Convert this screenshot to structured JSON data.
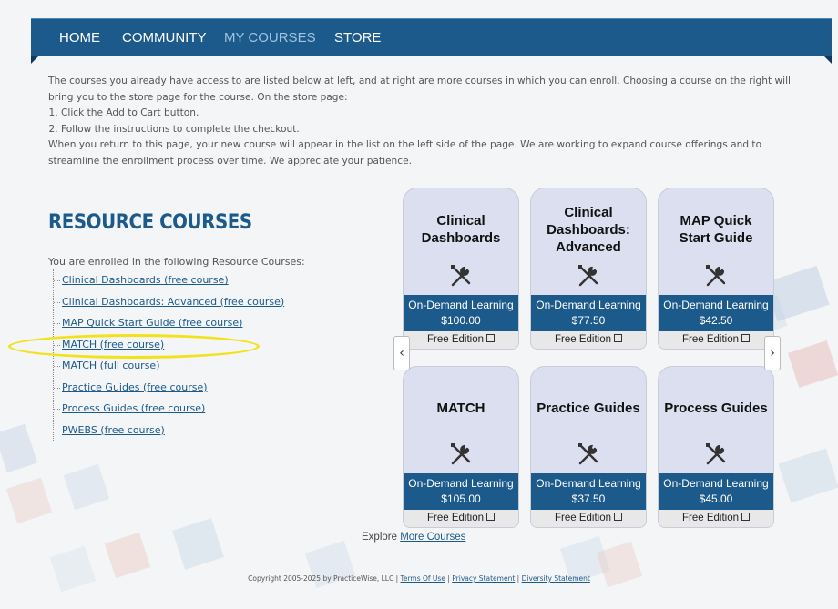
{
  "nav": {
    "items": [
      {
        "label": "HOME"
      },
      {
        "label": "COMMUNITY"
      },
      {
        "label": "MY COURSES"
      },
      {
        "label": "STORE"
      }
    ]
  },
  "intro": {
    "p1": "The courses you already have access to are listed below at left, and at right are more courses in which you can enroll. Choosing a course on the right will bring you to the store page for the course. On the store page:",
    "steps": [
      "Click the Add to Cart button.",
      "Follow the instructions to complete the checkout."
    ],
    "p2": "When you return to this page, your new course will appear in the list on the left side of the page. We are working to expand course offerings and to streamline the enrollment process over time. We appreciate your patience."
  },
  "resource": {
    "heading": "RESOURCE COURSES",
    "enrolled_label": "You are enrolled in the following Resource Courses:",
    "courses": [
      "Clinical Dashboards (free course)",
      "Clinical Dashboards: Advanced (free course)",
      "MAP Quick Start Guide (free course)",
      "MATCH (free course)",
      "MATCH (full course)",
      "Practice Guides (free course)",
      "Process Guides (free course)",
      "PWEBS (free course)"
    ]
  },
  "store": {
    "cards": [
      {
        "title": "Clinical Dashboards",
        "band": "On-Demand Learning",
        "price": "$100.00",
        "free": "Free Edition",
        "icon": "tools-icon"
      },
      {
        "title": "Clinical Dashboards: Advanced",
        "band": "On-Demand Learning",
        "price": "$77.50",
        "free": "Free Edition",
        "icon": "tools-icon"
      },
      {
        "title": "MAP Quick Start Guide",
        "band": "On-Demand Learning",
        "price": "$42.50",
        "free": "Free Edition",
        "icon": "tools-icon"
      },
      {
        "title": "MATCH",
        "band": "On-Demand Learning",
        "price": "$105.00",
        "free": "Free Edition",
        "icon": "tools-icon"
      },
      {
        "title": "Practice Guides",
        "band": "On-Demand Learning",
        "price": "$37.50",
        "free": "Free Edition",
        "icon": "tools-icon"
      },
      {
        "title": "Process Guides",
        "band": "On-Demand Learning",
        "price": "$45.00",
        "free": "Free Edition",
        "icon": "tools-icon"
      }
    ],
    "prev_arrow": "‹",
    "next_arrow": "›",
    "explore_prefix": "Explore",
    "explore_link": "More Courses"
  },
  "footer": {
    "copyright": "Copyright 2005-2025 by PracticeWise, LLC |",
    "terms": "Terms Of Use",
    "privacy": "Privacy Statement",
    "diversity": "Diversity Statement",
    "sep": "|"
  },
  "colors": {
    "brand": "#1d5a8c",
    "active_nav": "#9fc3e2",
    "highlight": "#f2e21a",
    "card_bg": "#dcdff0"
  }
}
